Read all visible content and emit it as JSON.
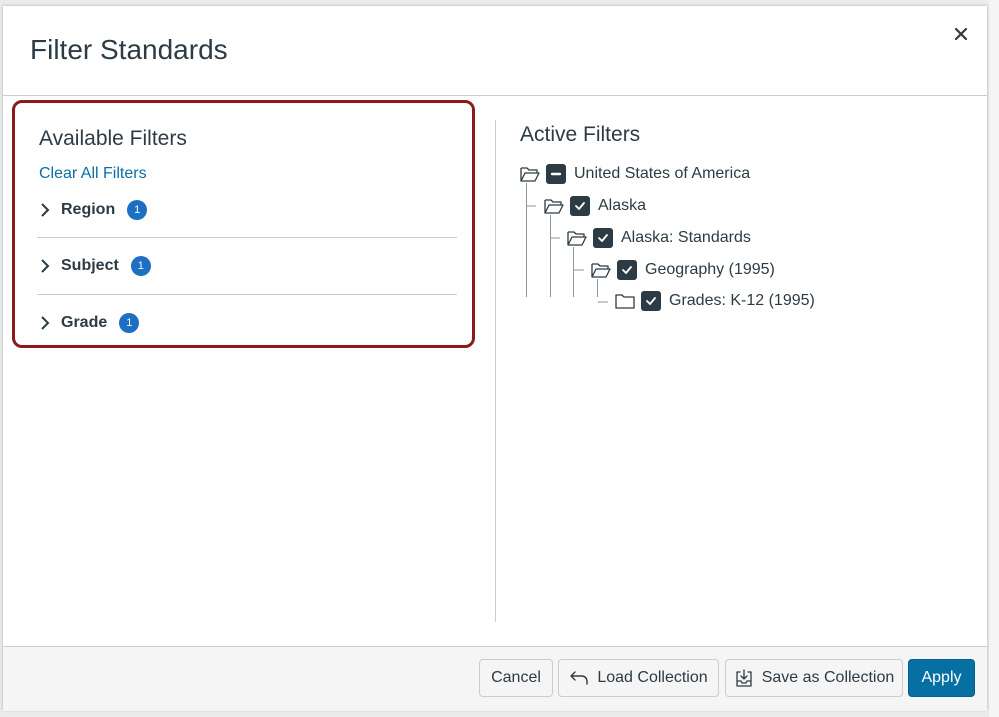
{
  "modal": {
    "title": "Filter Standards",
    "close_icon": "close-icon"
  },
  "available_filters": {
    "heading": "Available Filters",
    "clear_all": "Clear All Filters",
    "items": [
      {
        "label": "Region",
        "count": "1"
      },
      {
        "label": "Subject",
        "count": "1"
      },
      {
        "label": "Grade",
        "count": "1"
      }
    ]
  },
  "active_filters": {
    "heading": "Active Filters",
    "tree": [
      {
        "label": "United States of America",
        "state": "partial"
      },
      {
        "label": "Alaska",
        "state": "checked"
      },
      {
        "label": "Alaska: Standards",
        "state": "checked"
      },
      {
        "label": "Geography (1995)",
        "state": "checked"
      },
      {
        "label": "Grades: K-12 (1995)",
        "state": "checked"
      }
    ]
  },
  "footer": {
    "cancel": "Cancel",
    "load_collection": "Load Collection",
    "save_as_collection": "Save as Collection",
    "apply": "Apply"
  },
  "colors": {
    "accent": "#0770a3",
    "badge": "#1d6fc4",
    "highlight_border": "#8b1a1f",
    "checkbox": "#2d3b45"
  }
}
